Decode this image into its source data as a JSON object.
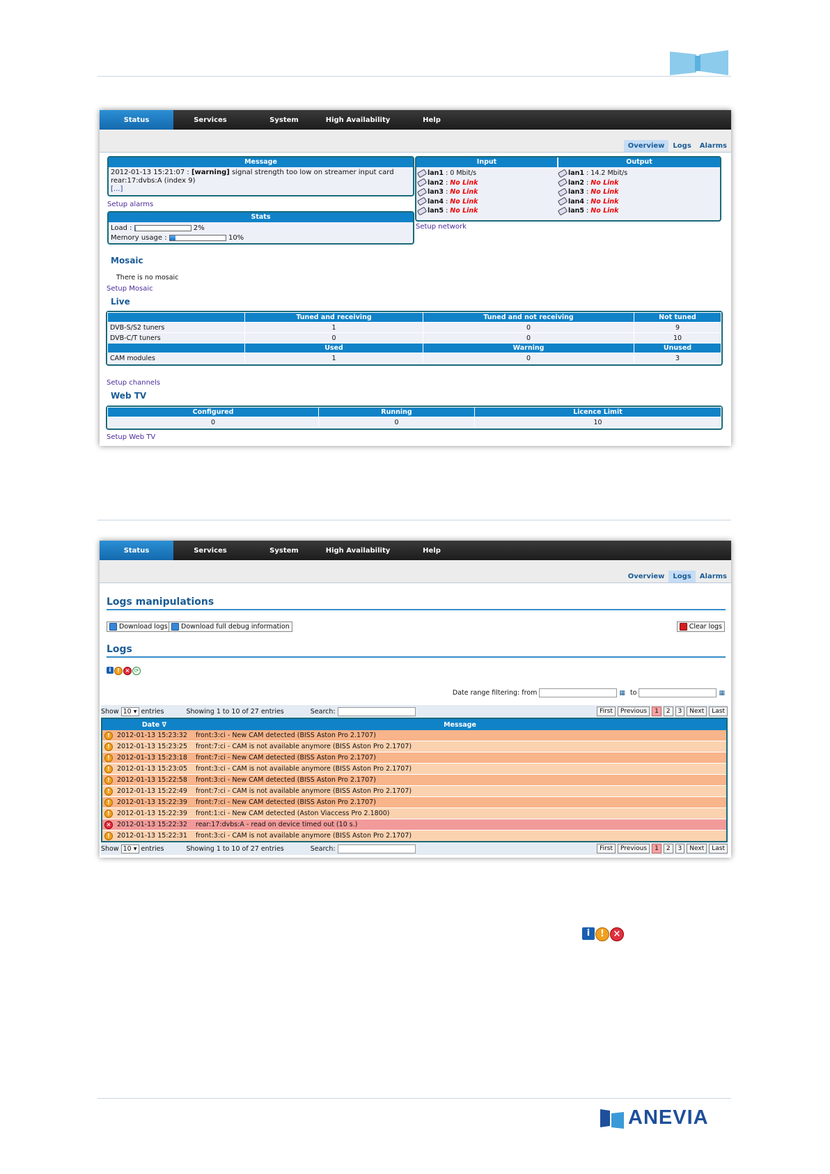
{
  "screen1": {
    "nav": [
      "Status",
      "Services",
      "System",
      "High Availability",
      "Help"
    ],
    "subtabs": [
      "Overview",
      "Logs",
      "Alarms"
    ],
    "message": {
      "header": "Message",
      "timestamp": "2012-01-13 15:21:07 : ",
      "level": "[warning]",
      "text1": " signal strength too low on streamer input card",
      "text2": "rear:17:dvbs:A (index 9)",
      "more": "[...]"
    },
    "setup_alarms": "Setup alarms",
    "stats": {
      "header": "Stats",
      "load_label": "Load :",
      "load_value": "2%",
      "load_fraction": 0.02,
      "memory_label": "Memory usage :",
      "memory_value": "10%",
      "memory_fraction": 0.1
    },
    "io": {
      "input_header": "Input",
      "output_header": "Output",
      "input": [
        {
          "name": "lan1",
          "sep": " : ",
          "value": "0 Mbit/s",
          "nolink": false
        },
        {
          "name": "lan2",
          "sep": " : ",
          "value": "No Link",
          "nolink": true
        },
        {
          "name": "lan3",
          "sep": " : ",
          "value": "No Link",
          "nolink": true
        },
        {
          "name": "lan4",
          "sep": " : ",
          "value": "No Link",
          "nolink": true
        },
        {
          "name": "lan5",
          "sep": " : ",
          "value": "No Link",
          "nolink": true
        }
      ],
      "output": [
        {
          "name": "lan1",
          "sep": " : ",
          "value": "14.2 Mbit/s",
          "nolink": false
        },
        {
          "name": "lan2",
          "sep": " : ",
          "value": "No Link",
          "nolink": true
        },
        {
          "name": "lan3",
          "sep": " : ",
          "value": "No Link",
          "nolink": true
        },
        {
          "name": "lan4",
          "sep": " : ",
          "value": "No Link",
          "nolink": true
        },
        {
          "name": "lan5",
          "sep": " : ",
          "value": "No Link",
          "nolink": true
        }
      ]
    },
    "setup_network": "Setup network",
    "mosaic": {
      "title": "Mosaic",
      "text": "There is no mosaic",
      "setup": "Setup Mosaic"
    },
    "live": {
      "title": "Live",
      "headers": [
        "",
        "Tuned and receiving",
        "Tuned and not receiving",
        "Not tuned"
      ],
      "rows": [
        [
          "DVB-S/S2 tuners",
          "1",
          "0",
          "9"
        ],
        [
          "DVB-C/T tuners",
          "0",
          "0",
          "10"
        ]
      ],
      "headers2": [
        "",
        "Used",
        "Warning",
        "Unused"
      ],
      "rows2": [
        [
          "CAM modules",
          "1",
          "0",
          "3"
        ]
      ],
      "setup": "Setup channels"
    },
    "webtv": {
      "title": "Web TV",
      "headers": [
        "Configured",
        "Running",
        "Licence Limit"
      ],
      "values": [
        "0",
        "0",
        "10"
      ],
      "setup": "Setup Web TV"
    }
  },
  "screen2": {
    "nav": [
      "Status",
      "Services",
      "System",
      "High Availability",
      "Help"
    ],
    "subtabs": [
      "Overview",
      "Logs",
      "Alarms"
    ],
    "logs_manip_title": "Logs manipulations",
    "download_logs": "Download logs",
    "download_debug": "Download full debug information",
    "clear_logs": "Clear logs",
    "logs_title": "Logs",
    "date_filter_label": "Date range filtering: from",
    "date_to": "to",
    "show_label": "Show",
    "show_value": "10",
    "entries_label": "entries",
    "showing": "Showing 1 to 10 of 27 entries",
    "search_label": "Search:",
    "pager": [
      "First",
      "Previous",
      "1",
      "2",
      "3",
      "Next",
      "Last"
    ],
    "col_date": "Date ∇",
    "col_message": "Message",
    "rows": [
      {
        "level": "warning",
        "date": "2012-01-13 15:23:32",
        "message": "front:3:ci - New CAM detected (BISS Aston Pro 2.1707)"
      },
      {
        "level": "warning",
        "date": "2012-01-13 15:23:25",
        "message": "front:7:ci - CAM is not available anymore (BISS Aston Pro 2.1707)"
      },
      {
        "level": "warning",
        "date": "2012-01-13 15:23:18",
        "message": "front:7:ci - New CAM detected (BISS Aston Pro 2.1707)"
      },
      {
        "level": "warning",
        "date": "2012-01-13 15:23:05",
        "message": "front:3:ci - CAM is not available anymore (BISS Aston Pro 2.1707)"
      },
      {
        "level": "warning",
        "date": "2012-01-13 15:22:58",
        "message": "front:3:ci - New CAM detected (BISS Aston Pro 2.1707)"
      },
      {
        "level": "warning",
        "date": "2012-01-13 15:22:49",
        "message": "front:7:ci - CAM is not available anymore (BISS Aston Pro 2.1707)"
      },
      {
        "level": "warning",
        "date": "2012-01-13 15:22:39",
        "message": "front:7:ci - New CAM detected (BISS Aston Pro 2.1707)"
      },
      {
        "level": "warning",
        "date": "2012-01-13 15:22:39",
        "message": "front:1:ci - New CAM detected (Aston Viaccess Pro 2.1800)"
      },
      {
        "level": "error",
        "date": "2012-01-13 15:22:32",
        "message": "rear:17:dvbs:A - read on device timed out (10 s.)"
      },
      {
        "level": "warning",
        "date": "2012-01-13 15:22:31",
        "message": "front:3:ci - CAM is not available anymore (BISS Aston Pro 2.1707)"
      }
    ]
  },
  "footer": {
    "brand": "ANEVIA"
  }
}
